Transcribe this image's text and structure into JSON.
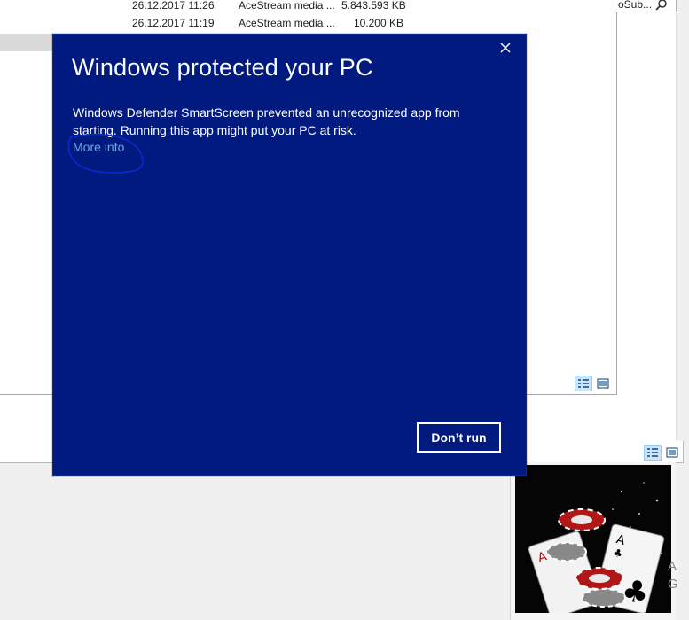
{
  "explorer": {
    "files": [
      {
        "date": "26.12.2017 11:26",
        "type": "AceStream media ...",
        "size": "5.843.593 KB"
      },
      {
        "date": "26.12.2017 11:19",
        "type": "AceStream media ...",
        "size": "10.200 KB"
      }
    ],
    "search_value": "oSub..."
  },
  "dialog": {
    "title": "Windows protected your PC",
    "message": "Windows Defender SmartScreen prevented an unrecognized app from starting. Running this app might put your PC at risk.",
    "more_info_label": "More info",
    "dont_run_label": "Don’t run",
    "close_icon": "close-icon"
  },
  "thumbnail": {
    "subject": "poker chips and playing cards",
    "edge_text": "A\nG"
  },
  "colors": {
    "dialog_bg": "#001a80",
    "link": "#6fa4e4",
    "annotation_circle": "#0a2ad0"
  }
}
